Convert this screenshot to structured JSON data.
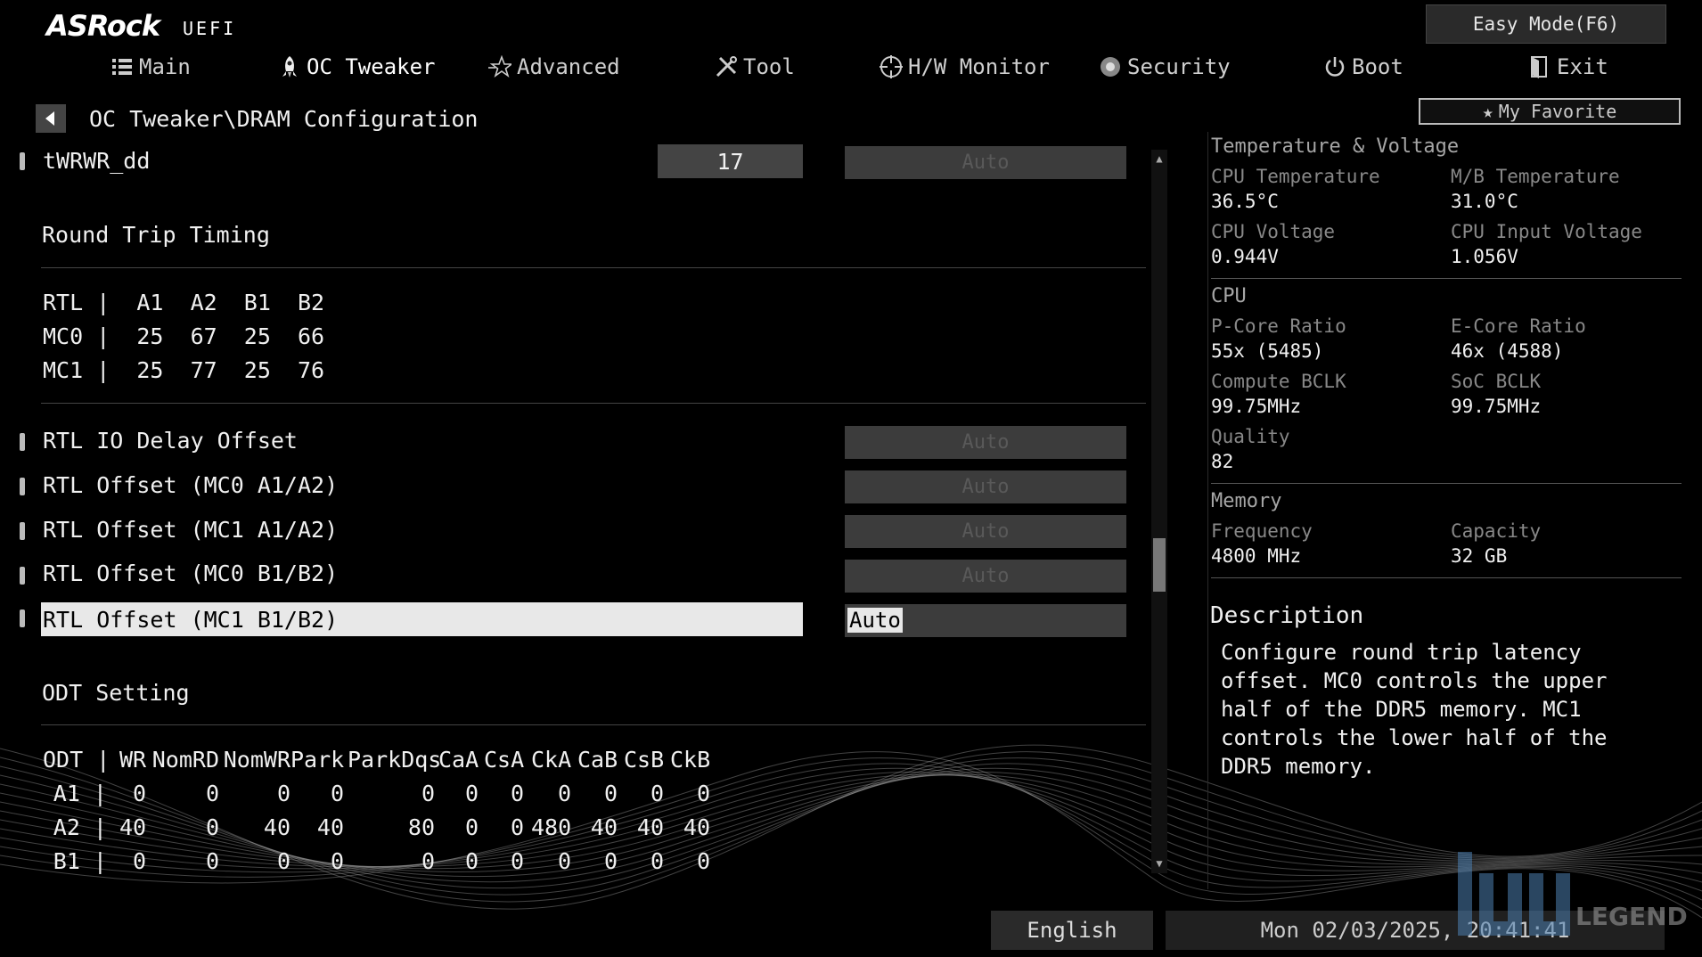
{
  "header": {
    "brand": "ASRock",
    "brand_sub": "UEFI",
    "easy_mode": "Easy Mode(F6)",
    "my_favorite": "My Favorite",
    "tabs": [
      {
        "label": "Main",
        "icon": "list-icon"
      },
      {
        "label": "OC Tweaker",
        "icon": "rocket-icon",
        "active": true
      },
      {
        "label": "Advanced",
        "icon": "star-icon"
      },
      {
        "label": "Tool",
        "icon": "tools-icon"
      },
      {
        "label": "H/W Monitor",
        "icon": "crosshair-icon"
      },
      {
        "label": "Security",
        "icon": "shield-icon"
      },
      {
        "label": "Boot",
        "icon": "power-icon"
      },
      {
        "label": "Exit",
        "icon": "exit-icon"
      }
    ]
  },
  "breadcrumb": "OC Tweaker\\DRAM Configuration",
  "settings": {
    "twrwr": {
      "label": "tWRWR_dd",
      "value": "17",
      "option": "Auto"
    },
    "round_trip_title": "Round Trip Timing",
    "rtl_table": [
      "RTL |  A1  A2  B1  B2",
      "MC0 |  25  67  25  66",
      "MC1 |  25  77  25  76"
    ],
    "rtl_items": [
      {
        "label": "RTL IO Delay Offset",
        "option": "Auto"
      },
      {
        "label": "RTL Offset (MC0 A1/A2)",
        "option": "Auto"
      },
      {
        "label": "RTL Offset (MC1 A1/A2)",
        "option": "Auto"
      },
      {
        "label": "RTL Offset (MC0 B1/B2)",
        "option": "Auto"
      },
      {
        "label": "RTL Offset (MC1 B1/B2)",
        "option": "Auto",
        "selected": true
      }
    ],
    "odt_title": "ODT Setting",
    "odt_header": [
      "ODT |",
      "WR",
      "NomRD",
      "NomWR",
      "Park",
      "ParkDqs",
      "CaA",
      "CsA",
      "CkA",
      "CaB",
      "CsB",
      "CkB"
    ],
    "odt_rows": [
      [
        "A1 |",
        "0",
        "0",
        "0",
        "0",
        "0",
        "0",
        "0",
        "0",
        "0",
        "0",
        "0"
      ],
      [
        "A2 |",
        "40",
        "0",
        "40",
        "40",
        "80",
        "0",
        "0",
        "480",
        "40",
        "40",
        "40"
      ],
      [
        "B1 |",
        "0",
        "0",
        "0",
        "0",
        "0",
        "0",
        "0",
        "0",
        "0",
        "0",
        "0"
      ]
    ]
  },
  "monitor": {
    "tv_title": "Temperature & Voltage",
    "cpu_temp_label": "CPU Temperature",
    "cpu_temp": "36.5°C",
    "mb_temp_label": "M/B Temperature",
    "mb_temp": "31.0°C",
    "cpu_volt_label": "CPU Voltage",
    "cpu_volt": "0.944V",
    "cpu_in_volt_label": "CPU Input Voltage",
    "cpu_in_volt": "1.056V",
    "cpu_title": "CPU",
    "pcore_label": "P-Core Ratio",
    "pcore": "55x (5485)",
    "ecore_label": "E-Core Ratio",
    "ecore": "46x (4588)",
    "bclk_label": "Compute BCLK",
    "bclk": "99.75MHz",
    "soc_label": "SoC BCLK",
    "soc": "99.75MHz",
    "quality_label": "Quality",
    "quality": "82",
    "mem_title": "Memory",
    "freq_label": "Frequency",
    "freq": "4800 MHz",
    "cap_label": "Capacity",
    "cap": "32 GB"
  },
  "description": {
    "title": "Description",
    "text": "Configure round trip latency offset. MC0 controls the upper half of the DDR5 memory. MC1 controls the lower half of the DDR5 memory."
  },
  "footer": {
    "language": "English",
    "datetime": "Mon 02/03/2025, 20:41:41"
  },
  "watermark": "LEGEND",
  "colors": {
    "selected_bg": "#e8e8e8",
    "selected_fg": "#000000",
    "disabled_box": "#3c3c3c"
  }
}
